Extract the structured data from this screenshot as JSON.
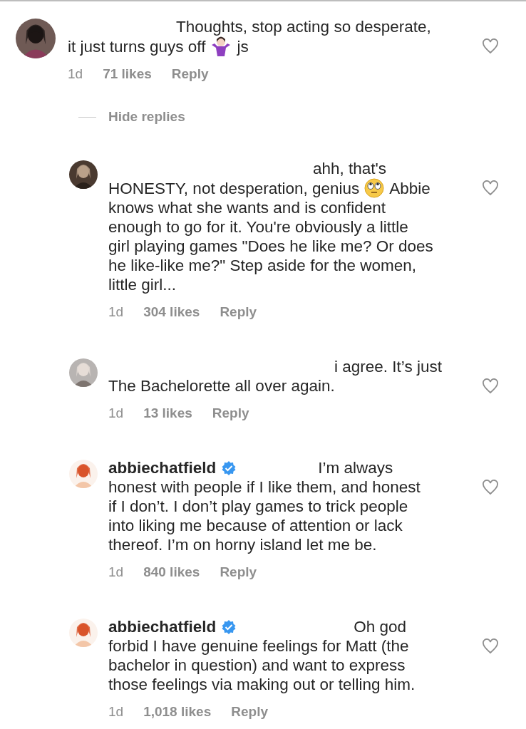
{
  "comments": [
    {
      "reply": false,
      "liked": false,
      "lines": [
        [
          {
            "kind": "text",
            "text": "Thoughts, stop acting so desperate,"
          }
        ],
        [
          {
            "kind": "text",
            "text": "it just turns guys off"
          },
          {
            "kind": "shrug"
          },
          {
            "kind": "text",
            "text": "js"
          }
        ]
      ],
      "time": "1d",
      "likes": "71 likes",
      "reply_label": "Reply",
      "avatar": {
        "kind": "picture"
      }
    },
    {
      "kind": "toggle",
      "label": "Hide replies"
    },
    {
      "reply": true,
      "liked": false,
      "lines": [
        [
          {
            "kind": "text",
            "text": "ahh, that's"
          }
        ],
        [
          {
            "kind": "text",
            "text": "HONESTY, not desperation, genius"
          },
          {
            "kind": "eyeroll"
          },
          {
            "kind": "text",
            "text": "Abbie"
          }
        ],
        [
          {
            "kind": "text",
            "text": "knows what she wants and is confident"
          }
        ],
        [
          {
            "kind": "text",
            "text": "enough to go for it. You're obviously a little"
          }
        ],
        [
          {
            "kind": "text",
            "text": "girl playing games \"Does he like me? Or does"
          }
        ],
        [
          {
            "kind": "text",
            "text": "he like-like me?\" Step aside for the women,"
          }
        ],
        [
          {
            "kind": "text",
            "text": "little girl..."
          }
        ]
      ],
      "time": "1d",
      "likes": "304 likes",
      "reply_label": "Reply",
      "avatar": {
        "kind": "picture"
      }
    },
    {
      "reply": true,
      "liked": false,
      "lines": [
        [
          {
            "kind": "text",
            "text": "i agree. It’s just"
          }
        ],
        [
          {
            "kind": "text",
            "text": "The Bachelorette all over again."
          }
        ]
      ],
      "time": "1d",
      "likes": "13 likes",
      "reply_label": "Reply",
      "avatar": {
        "kind": "picture"
      }
    },
    {
      "reply": true,
      "username": "abbiechatfield",
      "verified": true,
      "liked": false,
      "lines": [
        [
          {
            "kind": "text",
            "text": "I’m always"
          }
        ],
        [
          {
            "kind": "text",
            "text": "honest with people if I like them, and honest"
          }
        ],
        [
          {
            "kind": "text",
            "text": "if I don’t. I don’t play games to trick people"
          }
        ],
        [
          {
            "kind": "text",
            "text": "into liking me because of attention or lack"
          }
        ],
        [
          {
            "kind": "text",
            "text": "thereof. I’m on horny island let me be."
          }
        ]
      ],
      "time": "1d",
      "likes": "840 likes",
      "reply_label": "Reply",
      "avatar": {
        "kind": "picture"
      }
    },
    {
      "reply": true,
      "username": "abbiechatfield",
      "verified": true,
      "liked": false,
      "lines": [
        [
          {
            "kind": "text",
            "text": "Oh god"
          }
        ],
        [
          {
            "kind": "text",
            "text": "forbid I have genuine feelings for Matt (the"
          }
        ],
        [
          {
            "kind": "text",
            "text": "bachelor in question) and want to express"
          }
        ],
        [
          {
            "kind": "text",
            "text": "those feelings via making out or telling him."
          }
        ]
      ],
      "time": "1d",
      "likes": "1,018 likes",
      "reply_label": "Reply",
      "avatar": {
        "kind": "picture"
      }
    }
  ]
}
